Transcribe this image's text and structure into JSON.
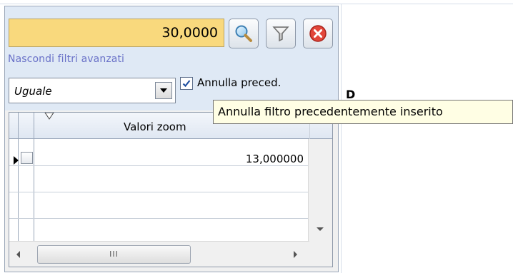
{
  "filter": {
    "value": "30,0000",
    "advanced_link": "Nascondi filtri avanzati",
    "operator": "Uguale",
    "annulla_label": "Annulla preced.",
    "annulla_checked": true
  },
  "toolbar": {
    "search_icon": "search-icon",
    "filter_icon": "funnel-icon",
    "clear_icon": "close-icon"
  },
  "grid": {
    "column_header": "Valori zoom",
    "rows": [
      {
        "value": "13,000000",
        "checked": false,
        "current": true
      },
      {
        "value": "",
        "checked": false,
        "current": false
      },
      {
        "value": "",
        "checked": false,
        "current": false
      },
      {
        "value": "",
        "checked": false,
        "current": false
      }
    ],
    "hscroll_thumb": "III"
  },
  "tooltip": {
    "text": "Annulla filtro precedentemente inserito"
  },
  "colors": {
    "filter_bg": "#f9d97d",
    "link": "#6a72c8",
    "tooltip_bg": "#fffee4"
  }
}
